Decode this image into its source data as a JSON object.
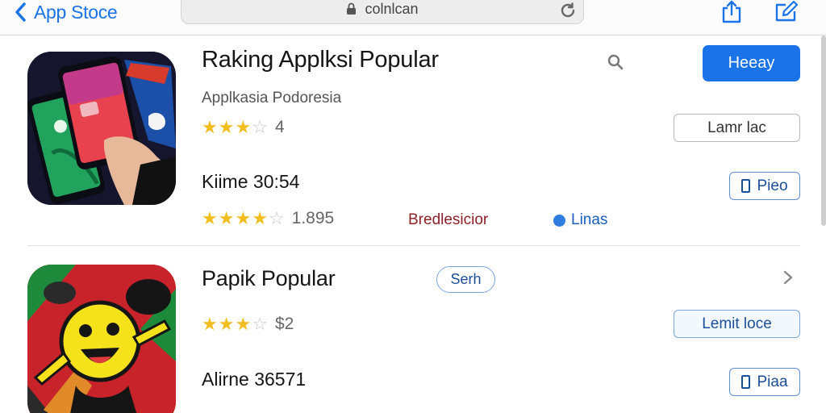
{
  "nav": {
    "back_label": "App Stoce",
    "url": "colnlcan"
  },
  "colors": {
    "accent": "#1a73e8",
    "star": "#f2bd1f",
    "link_red": "#8c2026"
  },
  "icons": [
    "chevron-left-icon",
    "lock-icon",
    "reload-icon",
    "share-icon",
    "edit-icon",
    "search-icon",
    "chevron-right-icon",
    "document-icon"
  ],
  "section1": {
    "title": "Raking Applksi Popular",
    "subtitle": "Applkasia Podoresia",
    "primary_button": "Heeay",
    "rating_stars": 3.5,
    "rating_text": "4",
    "outline_button": "Lamr lac",
    "subhead": "Kiime 30:54",
    "small_button": "Pieo",
    "rating2_stars": 4.5,
    "rating2_text": "1.895",
    "red_link": "Bredlesicior",
    "dot_link": "Linas"
  },
  "section2": {
    "title": "Papik Popular",
    "pill_button": "Serh",
    "rating_stars": 3.5,
    "rating_text": "$2",
    "outline_button": "Lemit loce",
    "subhead": "Alirne 36571",
    "small_button": "Piaa"
  }
}
